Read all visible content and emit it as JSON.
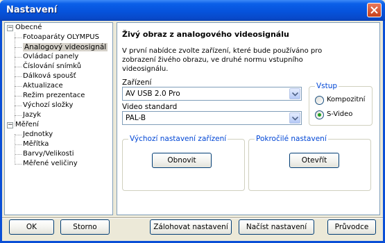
{
  "window": {
    "title": "Nastavení"
  },
  "tree": {
    "groups": [
      {
        "label": "Obecné",
        "expander": "−",
        "items": [
          "Fotoaparáty OLYMPUS",
          "Analogový videosignál",
          "Ovládací panely",
          "Číslování snímků",
          "Dálková spoušť",
          "Aktualizace",
          "Režim prezentace",
          "Výchozí složky",
          "Jazyk"
        ]
      },
      {
        "label": "Měření",
        "expander": "−",
        "items": [
          "Jednotky",
          "Měřítka",
          "Barvy/Velikosti",
          "Měřené veličiny"
        ]
      }
    ],
    "selected": "Analogový videosignál"
  },
  "panel": {
    "heading": "Živý obraz z analogového videosignálu",
    "description": "V první nabídce zvolte zařízení, které bude používáno pro zobrazení živého obrazu, ve druhé normu vstupního videosignálu.",
    "device_label": "Zařízení",
    "device_value": "AV USB 2.0 Pro",
    "video_standard_label": "Video standard",
    "video_standard_value": "PAL-B",
    "input_group": {
      "title": "Vstup",
      "options": [
        "Kompozitní",
        "S-Video"
      ],
      "selected": "S-Video"
    },
    "defaults_group": {
      "title": "Výchozí nastavení zařízení",
      "button": "Obnovit"
    },
    "advanced_group": {
      "title": "Pokročilé nastavení",
      "button": "Otevřít"
    }
  },
  "footer": {
    "ok": "OK",
    "cancel": "Storno",
    "backup": "Zálohovat nastavení",
    "load": "Načíst nastavení",
    "wizard": "Průvodce"
  },
  "colors": {
    "titlebar": "#0a5fe8",
    "group_title": "#0046d5",
    "selected_radio": "#21a121"
  }
}
